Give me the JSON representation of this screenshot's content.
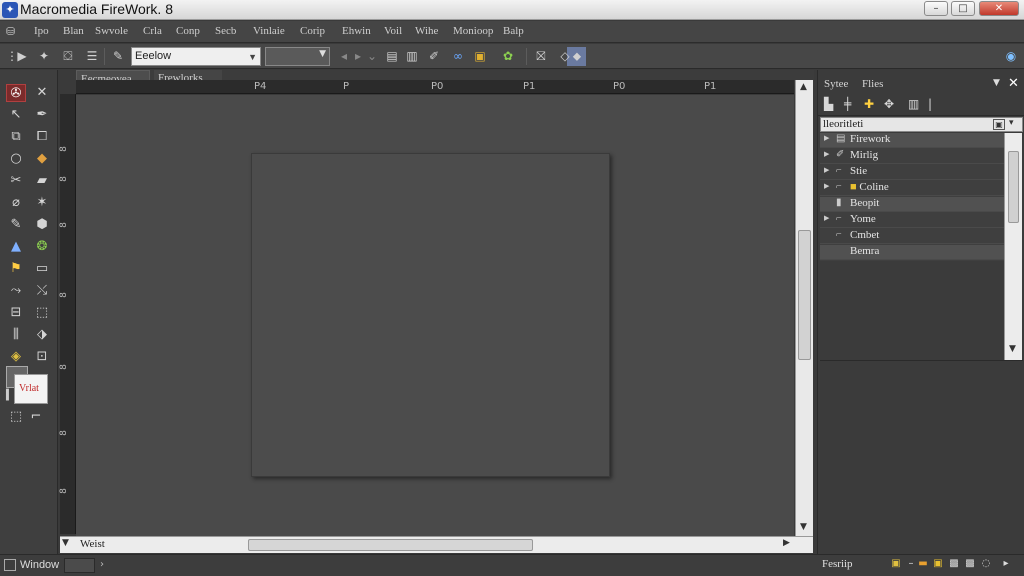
{
  "window": {
    "title": "Macromedia FireWork. 8",
    "minimize": "–",
    "maximize": "□",
    "close": "✕"
  },
  "menu": {
    "items": [
      "Ipo",
      "Blan",
      "Swvole",
      "Crla",
      "Conp",
      "Secb",
      "Vinlaie",
      "Corip",
      "Ehwin",
      "Voil",
      "Wihe",
      "Monioop",
      "Balp"
    ]
  },
  "toolbar": {
    "font_value": "Eeelow"
  },
  "doc_tabs": {
    "tab1": "Eecmeovea",
    "tab2": "Frewlorks"
  },
  "ruler": {
    "h_labels": [
      "P4",
      "P",
      "P0",
      "P1",
      "P0",
      "P1"
    ],
    "v_labels": [
      "8",
      "8",
      "8",
      "8",
      "8",
      "8",
      "8"
    ]
  },
  "scroll": {
    "h_label": "Weist"
  },
  "right_panel": {
    "tab1": "Sytee",
    "tab2": "Flies",
    "field_label": "lleoritleti",
    "rows": [
      {
        "label": "Firework",
        "icon": "page-icon",
        "has_arrow": true
      },
      {
        "label": "Mirlig",
        "icon": "pen-icon",
        "has_arrow": true
      },
      {
        "label": "Stie",
        "icon": "hook-icon",
        "has_arrow": true
      },
      {
        "label": "Coline",
        "icon": "folder-icon",
        "has_arrow": true
      },
      {
        "label": "Beopit",
        "icon": "doc-icon",
        "has_arrow": false
      },
      {
        "label": "Yome",
        "icon": "hook-icon",
        "has_arrow": true
      },
      {
        "label": "Cmbet",
        "icon": "hook-icon",
        "has_arrow": false
      },
      {
        "label": "Bemra",
        "icon": "",
        "has_arrow": false
      }
    ],
    "bottom_label": "Fesriip"
  },
  "tools": {
    "fill_label": "Vrlat"
  },
  "status": {
    "window_label": "Window",
    "right_label": "Fesriip"
  },
  "colors": {
    "accent_selected_tool": "#7b2b2b",
    "ruler_marker": "#d9c52e",
    "close_button": "#c0392b"
  }
}
